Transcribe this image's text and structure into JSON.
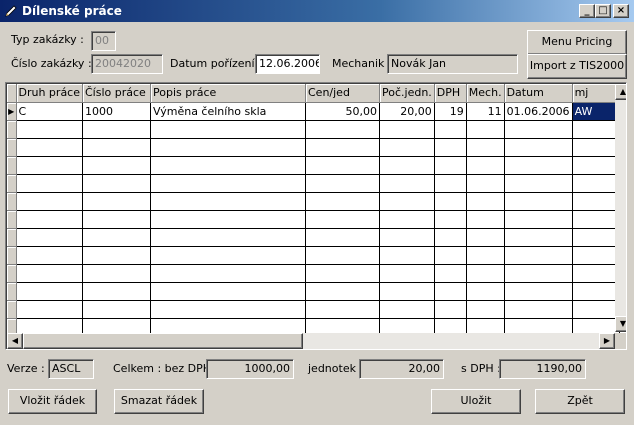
{
  "window": {
    "title": "Dílenské práce",
    "controls": {
      "minimize": "_",
      "maximize": "□",
      "close": "×"
    }
  },
  "header": {
    "typ_zakazky_label": "Typ zakázky :",
    "typ_zakazky_value": "00",
    "cislo_zakazky_label": "Číslo zakázky :",
    "cislo_zakazky_value": "20042020",
    "datum_porizeni_label": "Datum pořízení :",
    "datum_porizeni_value": "12.06.2006",
    "mechanik_label": "Mechanik :",
    "mechanik_value": "Novák Jan"
  },
  "buttons": {
    "menu_pricing": "Menu Pricing",
    "import_tis": "Import z TIS2000",
    "vlozit_radek": "Vložit řádek",
    "smazat_radek": "Smazat řádek",
    "ulozit": "Uložit",
    "zpet": "Zpět"
  },
  "grid": {
    "columns": [
      "Druh práce",
      "Číslo práce",
      "Popis práce",
      "Cen/jed",
      "Poč.jedn.",
      "DPH",
      "Mech.",
      "Datum",
      "mj"
    ],
    "rows": [
      [
        "C",
        "1000",
        "Výměna čelního skla",
        "50,00",
        "20,00",
        "19",
        "11",
        "01.06.2006",
        "AW"
      ]
    ],
    "empty_rows": 12
  },
  "footer": {
    "verze_label": "Verze :",
    "verze_value": "ASCL",
    "celkem_label": "Celkem : bez DPH :",
    "celkem_value": "1000,00",
    "jednotek_label": "jednotek :",
    "jednotek_value": "20,00",
    "s_dph_label": "s DPH :",
    "s_dph_value": "1190,00"
  },
  "icons": {
    "app": "pencil-icon",
    "row_indicator": "current-row-arrow-icon",
    "scroll_up": "arrow-up-icon",
    "scroll_down": "arrow-down-icon",
    "scroll_left": "arrow-left-icon",
    "scroll_right": "arrow-right-icon"
  },
  "colors": {
    "titlebar_start": "#0a246a",
    "titlebar_end": "#a6caf0",
    "selection": "#0a246a",
    "face": "#d4d0c8"
  }
}
